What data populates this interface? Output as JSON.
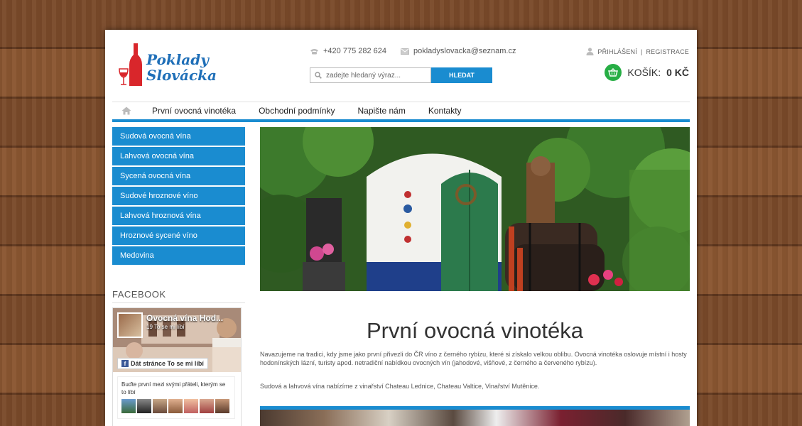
{
  "brand": {
    "line1": "Poklady",
    "line2": "Slovácka"
  },
  "contact": {
    "phone": "+420 775 282 624",
    "email": "pokladyslovacka@seznam.cz"
  },
  "search": {
    "placeholder": "zadejte hledaný výraz...",
    "button": "HLEDAT"
  },
  "account": {
    "login": "PŘIHLÁŠENÍ",
    "separator": "|",
    "register": "REGISTRACE"
  },
  "cart": {
    "label": "KOŠÍK:",
    "total": "0 KČ"
  },
  "nav": {
    "items": [
      "První ovocná vinotéka",
      "Obchodní podmínky",
      "Napište nám",
      "Kontakty"
    ]
  },
  "categories": [
    "Sudová ovocná vína",
    "Lahvová ovocná vína",
    "Sycená ovocná vína",
    "Sudové hroznové víno",
    "Lahvová hroznová vína",
    "Hroznové sycené víno",
    "Medovina"
  ],
  "facebook": {
    "heading": "FACEBOOK",
    "page_name": "Ovocná vína Hod...",
    "likes": "19 To se mi líbí",
    "like_button": "Dát stránce To se mi líbí",
    "friends_text": "Buďte první mezi svými přáteli, kterým se to líbí"
  },
  "main": {
    "title": "První ovocná vinotéka",
    "paragraph1": "Navazujeme na tradici, kdy jsme jako první přivezli do ČR víno z černého rybízu, které si získalo velkou oblibu. Ovocná vinotéka oslovuje místní i hosty hodonínských lázní, turisty apod. netradiční nabídkou ovocných vín (jahodové, višňové, z černého a červeného rybízu).",
    "paragraph2": "Sudová a lahvová vína nabízíme z vinařství Chateau Lednice, Chateau Valtice, Vinařství Mutěnice."
  },
  "colors": {
    "accent": "#1a8cd0",
    "cart": "#27ae45",
    "logo": "#1f6fb8",
    "bottle": "#d9262b"
  },
  "icons": [
    "phone-icon",
    "envelope-icon",
    "search-icon",
    "user-icon",
    "basket-icon",
    "home-icon",
    "facebook-icon"
  ]
}
